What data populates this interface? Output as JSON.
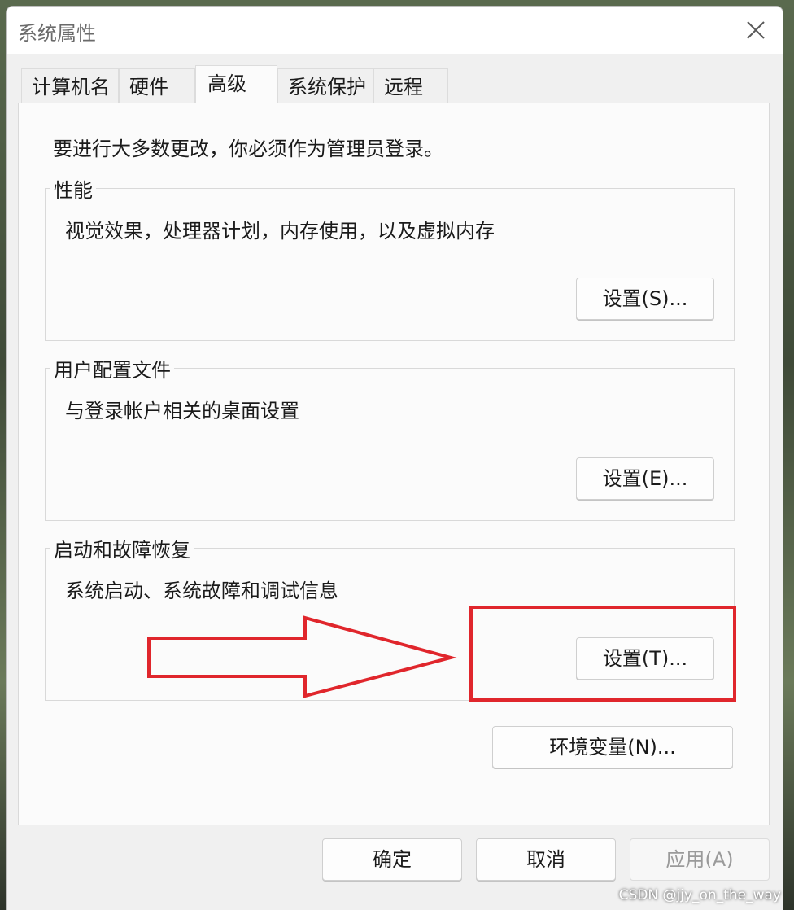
{
  "window": {
    "title": "系统属性"
  },
  "tabs": [
    {
      "label": "计算机名"
    },
    {
      "label": "硬件"
    },
    {
      "label": "高级",
      "active": true
    },
    {
      "label": "系统保护"
    },
    {
      "label": "远程"
    }
  ],
  "notice": "要进行大多数更改，你必须作为管理员登录。",
  "groups": [
    {
      "title": "性能",
      "description": "视觉效果，处理器计划，内存使用，以及虚拟内存",
      "button": "设置(S)..."
    },
    {
      "title": "用户配置文件",
      "description": "与登录帐户相关的桌面设置",
      "button": "设置(E)..."
    },
    {
      "title": "启动和故障恢复",
      "description": "系统启动、系统故障和调试信息",
      "button": "设置(T)..."
    }
  ],
  "env_button": "环境变量(N)...",
  "footer": {
    "ok": "确定",
    "cancel": "取消",
    "apply": "应用(A)"
  },
  "watermark": "CSDN @jjy_on_the_way",
  "annotation_color": "#e0262c",
  "icons": {
    "close": "close-icon",
    "arrow": "arrow-right-annotation"
  }
}
